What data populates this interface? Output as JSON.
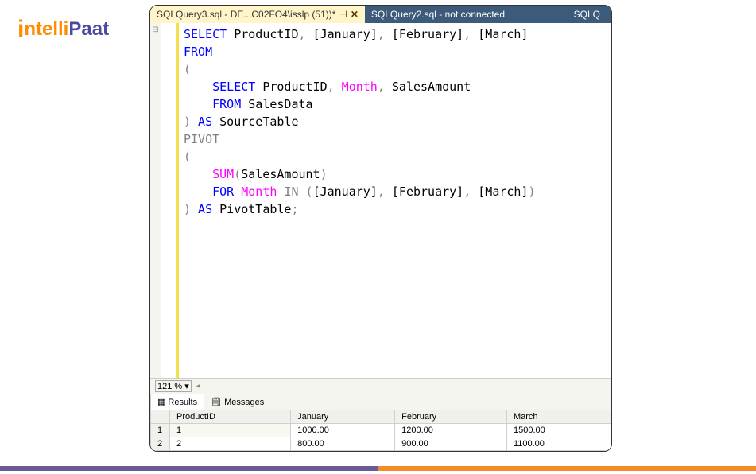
{
  "logo": {
    "brand1": "ntelli",
    "brand2": "Paat"
  },
  "tabs": {
    "active": "SQLQuery3.sql - DE...C02FO4\\isslp (51))*",
    "inactive": "SQLQuery2.sql - not connected",
    "right_label": "SQLQ"
  },
  "code": {
    "l1": {
      "a": "SELECT",
      "b": " ProductID",
      "c": ",",
      "d": " [January]",
      "e": ",",
      "f": " [February]",
      "g": ",",
      "h": " [March]"
    },
    "l2": {
      "a": "FROM"
    },
    "l3": {
      "a": "("
    },
    "l4": {
      "a": "    ",
      "b": "SELECT",
      "c": " ProductID",
      "d": ",",
      "e": " Month",
      "f": ",",
      "g": " SalesAmount"
    },
    "l5": {
      "a": "    ",
      "b": "FROM",
      "c": " SalesData"
    },
    "l6": {
      "a": ")",
      "b": " AS",
      "c": " SourceTable"
    },
    "l7": {
      "a": "PIVOT"
    },
    "l8": {
      "a": "("
    },
    "l9": {
      "a": "    ",
      "b": "SUM",
      "c": "(",
      "d": "SalesAmount",
      "e": ")"
    },
    "l10": {
      "a": "    ",
      "b": "FOR",
      "c": " Month ",
      "d": "IN",
      "e": " (",
      "f": "[January]",
      "g": ",",
      "h": " [February]",
      "i": ",",
      "j": " [March]",
      "k": ")"
    },
    "l11": {
      "a": ")",
      "b": " AS",
      "c": " PivotTable",
      "d": ";"
    }
  },
  "zoom": "121 %",
  "results_tabs": {
    "results": "Results",
    "messages": "Messages"
  },
  "grid": {
    "headers": [
      "ProductID",
      "January",
      "February",
      "March"
    ],
    "rows": [
      {
        "num": "1",
        "cells": [
          "1",
          "1000.00",
          "1200.00",
          "1500.00"
        ]
      },
      {
        "num": "2",
        "cells": [
          "2",
          "800.00",
          "900.00",
          "1100.00"
        ]
      }
    ]
  }
}
